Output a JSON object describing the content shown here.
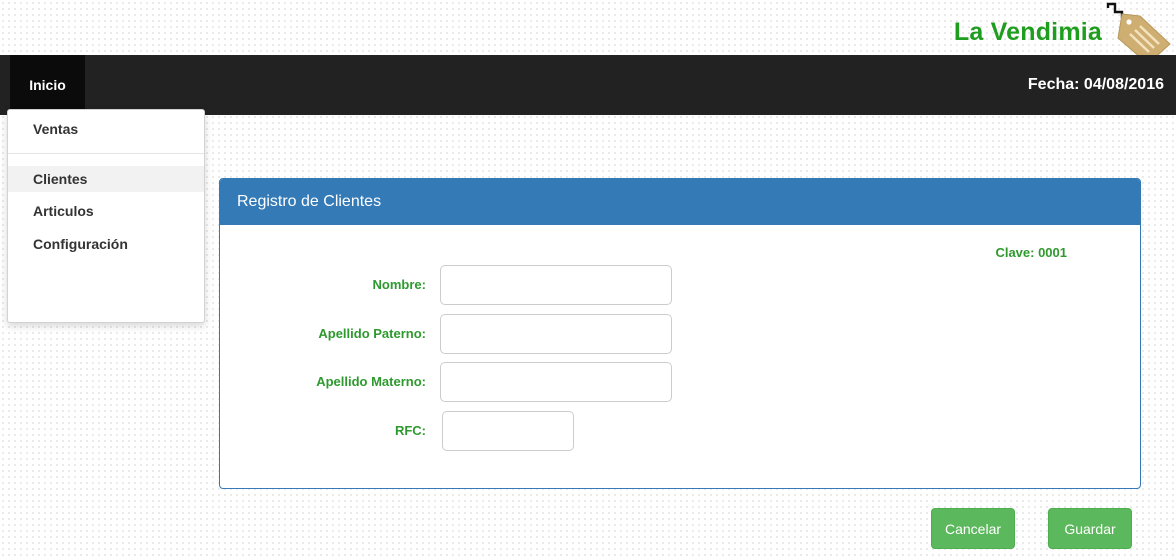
{
  "brand": {
    "name": "La Vendimia",
    "logo_icon": "price-tag-icon",
    "color": "#1f9d1f"
  },
  "navbar": {
    "home_label": "Inicio",
    "date_text": "Fecha: 04/08/2016",
    "background": "#222222"
  },
  "menu": {
    "items": [
      {
        "label": "Ventas"
      },
      {
        "label": "Clientes"
      },
      {
        "label": "Articulos"
      },
      {
        "label": "Configuración"
      }
    ],
    "active": "Clientes"
  },
  "panel": {
    "title": "Registro de Clientes",
    "clave": "Clave: 0001",
    "accent_color": "#337ab7",
    "fields": [
      {
        "label": "Nombre:",
        "value": "",
        "placeholder": ""
      },
      {
        "label": "Apellido Paterno:",
        "value": "",
        "placeholder": ""
      },
      {
        "label": "Apellido Materno:",
        "value": "",
        "placeholder": ""
      },
      {
        "label": "RFC:",
        "value": "",
        "placeholder": ""
      }
    ]
  },
  "actions": {
    "cancel_label": "Cancelar",
    "save_label": "Guardar",
    "button_color": "#5cb85c"
  }
}
